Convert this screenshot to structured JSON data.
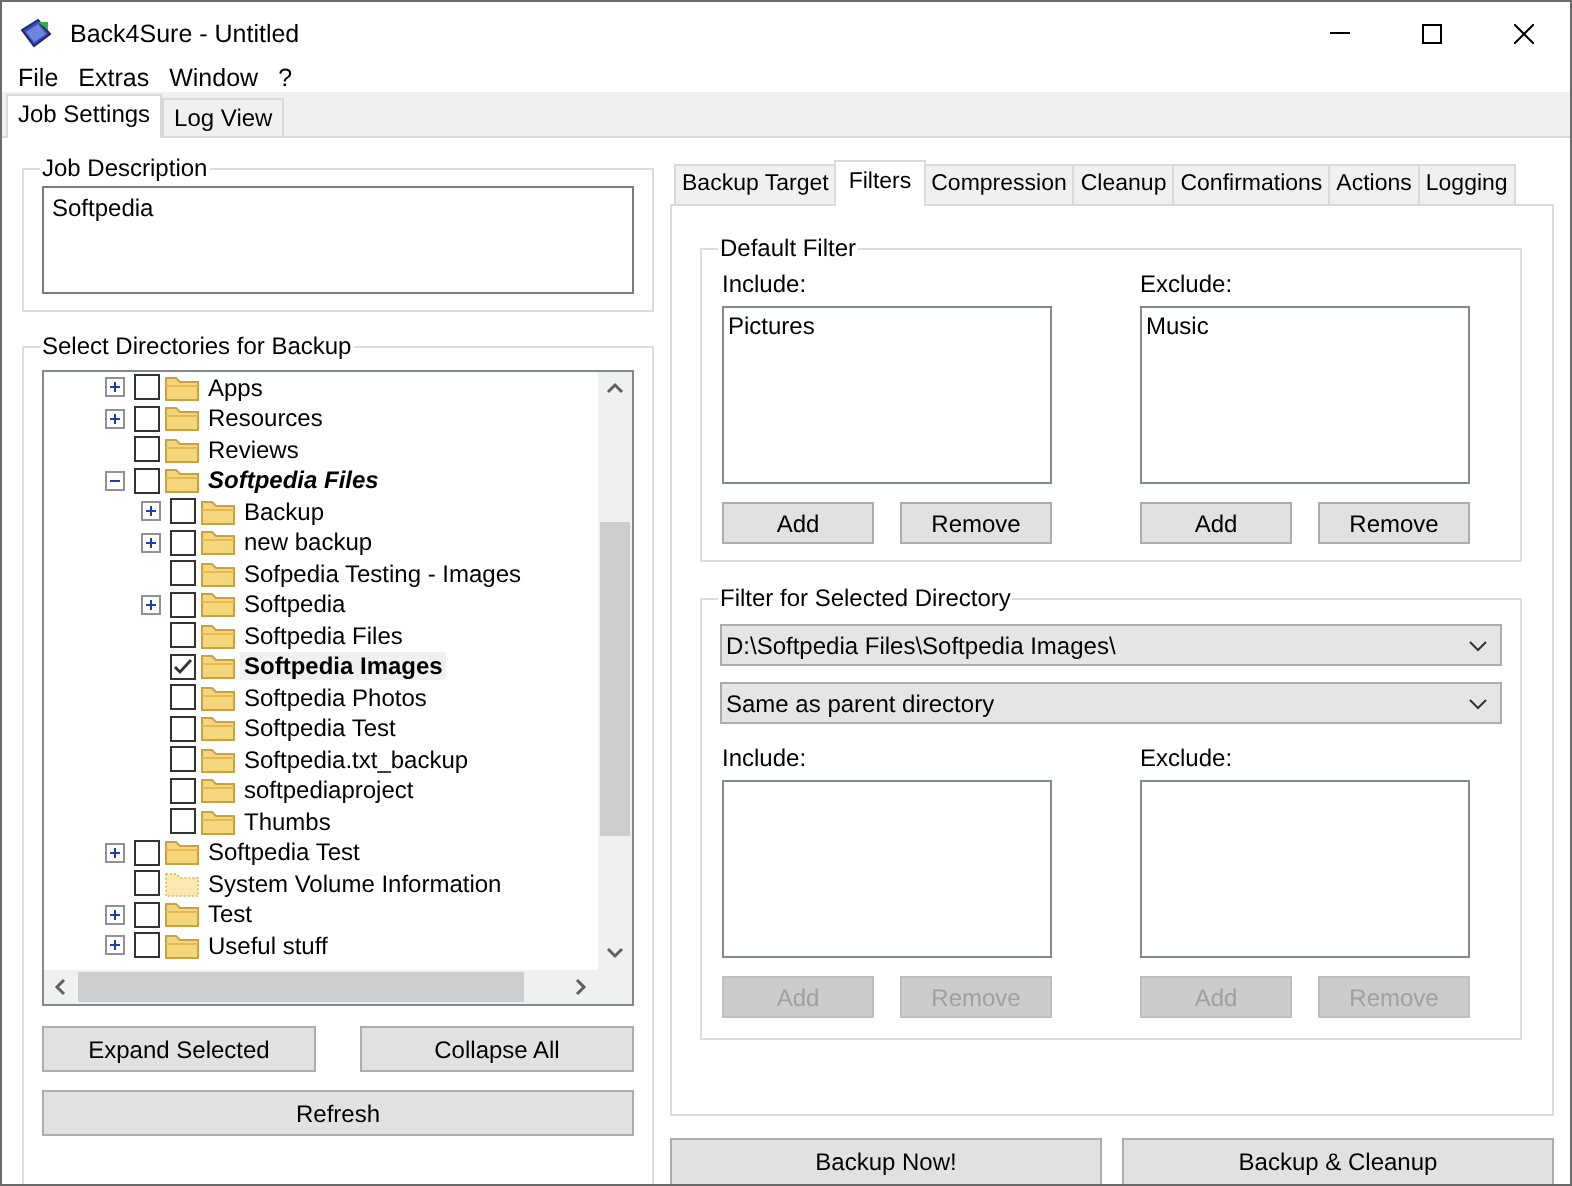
{
  "window": {
    "title": "Back4Sure - Untitled"
  },
  "menu": [
    "File",
    "Extras",
    "Window",
    "?"
  ],
  "main_tabs": [
    {
      "label": "Job Settings",
      "selected": true
    },
    {
      "label": "Log View",
      "selected": false
    }
  ],
  "job_description": {
    "legend": "Job Description",
    "value": "Softpedia"
  },
  "directories": {
    "legend": "Select Directories for Backup",
    "tree": [
      {
        "name": "Apps",
        "expandable": true,
        "expanded": false,
        "checked": false,
        "selected": false,
        "emphasized": false,
        "hidden": false
      },
      {
        "name": "Resources",
        "expandable": true,
        "expanded": false,
        "checked": false,
        "selected": false,
        "emphasized": false,
        "hidden": false
      },
      {
        "name": "Reviews",
        "expandable": false,
        "checked": false,
        "selected": false,
        "emphasized": false,
        "hidden": false
      },
      {
        "name": "Softpedia Files",
        "expandable": true,
        "expanded": true,
        "checked": false,
        "selected": false,
        "emphasized": true,
        "hidden": false,
        "children": [
          {
            "name": "Backup",
            "expandable": true,
            "expanded": false,
            "checked": false,
            "selected": false,
            "emphasized": false,
            "hidden": false
          },
          {
            "name": "new backup",
            "expandable": true,
            "expanded": false,
            "checked": false,
            "selected": false,
            "emphasized": false,
            "hidden": false
          },
          {
            "name": "Sofpedia Testing - Images",
            "expandable": false,
            "checked": false,
            "selected": false,
            "emphasized": false,
            "hidden": false
          },
          {
            "name": "Softpedia",
            "expandable": true,
            "expanded": false,
            "checked": false,
            "selected": false,
            "emphasized": false,
            "hidden": false
          },
          {
            "name": "Softpedia Files",
            "expandable": false,
            "checked": false,
            "selected": false,
            "emphasized": false,
            "hidden": false
          },
          {
            "name": "Softpedia Images",
            "expandable": false,
            "checked": true,
            "selected": true,
            "emphasized": false,
            "hidden": false
          },
          {
            "name": "Softpedia Photos",
            "expandable": false,
            "checked": false,
            "selected": false,
            "emphasized": false,
            "hidden": false
          },
          {
            "name": "Softpedia Test",
            "expandable": false,
            "checked": false,
            "selected": false,
            "emphasized": false,
            "hidden": false
          },
          {
            "name": "Softpedia.txt_backup",
            "expandable": false,
            "checked": false,
            "selected": false,
            "emphasized": false,
            "hidden": false
          },
          {
            "name": "softpediaproject",
            "expandable": false,
            "checked": false,
            "selected": false,
            "emphasized": false,
            "hidden": false
          },
          {
            "name": "Thumbs",
            "expandable": false,
            "checked": false,
            "selected": false,
            "emphasized": false,
            "hidden": false
          }
        ]
      },
      {
        "name": "Softpedia Test",
        "expandable": true,
        "expanded": false,
        "checked": false,
        "selected": false,
        "emphasized": false,
        "hidden": false
      },
      {
        "name": "System Volume Information",
        "expandable": false,
        "checked": false,
        "selected": false,
        "emphasized": false,
        "hidden": true
      },
      {
        "name": "Test",
        "expandable": true,
        "expanded": false,
        "checked": false,
        "selected": false,
        "emphasized": false,
        "hidden": false
      },
      {
        "name": "Useful stuff",
        "expandable": true,
        "expanded": false,
        "checked": false,
        "selected": false,
        "emphasized": false,
        "hidden": false
      }
    ]
  },
  "left_buttons": [
    "Expand Selected",
    "Collapse All",
    "Refresh"
  ],
  "settings_tabs": [
    {
      "label": "Backup Target",
      "selected": false
    },
    {
      "label": "Filters",
      "selected": true
    },
    {
      "label": "Compression",
      "selected": false
    },
    {
      "label": "Cleanup",
      "selected": false
    },
    {
      "label": "Confirmations",
      "selected": false
    },
    {
      "label": "Actions",
      "selected": false
    },
    {
      "label": "Logging",
      "selected": false
    }
  ],
  "default_filter": {
    "legend": "Default Filter",
    "include": {
      "label": "Include:",
      "items": [
        "Pictures"
      ],
      "buttons": [
        {
          "label": "Add",
          "disabled": false
        },
        {
          "label": "Remove",
          "disabled": false
        }
      ]
    },
    "exclude": {
      "label": "Exclude:",
      "items": [
        "Music"
      ],
      "buttons": [
        {
          "label": "Add",
          "disabled": false
        },
        {
          "label": "Remove",
          "disabled": false
        }
      ]
    }
  },
  "selected_filter": {
    "legend": "Filter for Selected Directory",
    "directory": "D:\\Softpedia Files\\Softpedia Images\\",
    "mode": "Same as parent directory",
    "include": {
      "label": "Include:",
      "buttons": [
        {
          "label": "Add",
          "disabled": true
        },
        {
          "label": "Remove",
          "disabled": true
        }
      ]
    },
    "exclude": {
      "label": "Exclude:",
      "buttons": [
        {
          "label": "Add",
          "disabled": true
        },
        {
          "label": "Remove",
          "disabled": true
        }
      ]
    }
  },
  "bottom_buttons": [
    "Backup Now!",
    "Backup & Cleanup"
  ]
}
